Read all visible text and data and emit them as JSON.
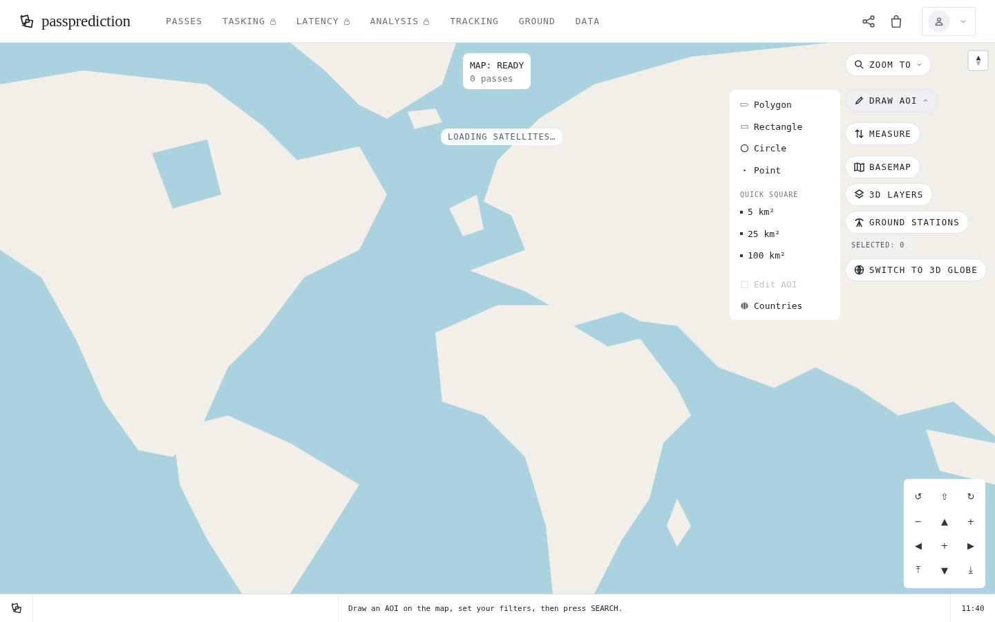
{
  "header": {
    "brand": "passprediction",
    "nav": [
      {
        "label": "PASSES",
        "locked": false
      },
      {
        "label": "TASKING",
        "locked": true
      },
      {
        "label": "LATENCY",
        "locked": true
      },
      {
        "label": "ANALYSIS",
        "locked": true
      },
      {
        "label": "TRACKING",
        "locked": false
      },
      {
        "label": "GROUND",
        "locked": false
      },
      {
        "label": "DATA",
        "locked": false
      }
    ]
  },
  "map": {
    "status": {
      "title": "MAP: READY",
      "passes": "0 passes"
    },
    "loading": "LOADING SATELLITES…",
    "draw_menu": {
      "shapes": [
        {
          "kind": "polygon",
          "label": "Polygon",
          "disabled": false
        },
        {
          "kind": "rectangle",
          "label": "Rectangle",
          "disabled": false
        },
        {
          "kind": "circle",
          "label": "Circle",
          "disabled": false
        },
        {
          "kind": "point",
          "label": "Point",
          "disabled": false
        }
      ],
      "quick_heading": "QUICK SQUARE",
      "quick": [
        "5 km²",
        "25 km²",
        "100 km²"
      ],
      "extras": [
        {
          "kind": "edit",
          "label": "Edit AOI",
          "disabled": true
        },
        {
          "kind": "countries",
          "label": "Countries",
          "disabled": false
        }
      ]
    },
    "tools": [
      {
        "kind": "zoom",
        "label": "ZOOM TO",
        "dropdown": true,
        "expanded": false
      },
      {
        "kind": "draw",
        "label": "DRAW AOI",
        "dropdown": true,
        "expanded": true
      },
      {
        "kind": "measure",
        "label": "MEASURE",
        "dropdown": false,
        "expanded": false
      },
      {
        "kind": "basemap",
        "label": "BASEMAP",
        "dropdown": false,
        "expanded": false
      },
      {
        "kind": "layers",
        "label": "3D LAYERS",
        "dropdown": false,
        "expanded": false
      },
      {
        "kind": "stations",
        "label": "GROUND STATIONS",
        "dropdown": false,
        "expanded": false
      }
    ],
    "selected": "SELECTED: 0",
    "globe": "SWITCH TO 3D GLOBE",
    "pad": [
      "↺",
      "⇧",
      "↻",
      "−",
      "▲",
      "+",
      "◀",
      "+",
      "▶",
      "⤒",
      "▼",
      "⤓"
    ]
  },
  "status_bar": {
    "message": "Draw an AOI on the map, set your filters, then press SEARCH.",
    "time": "11:40"
  }
}
